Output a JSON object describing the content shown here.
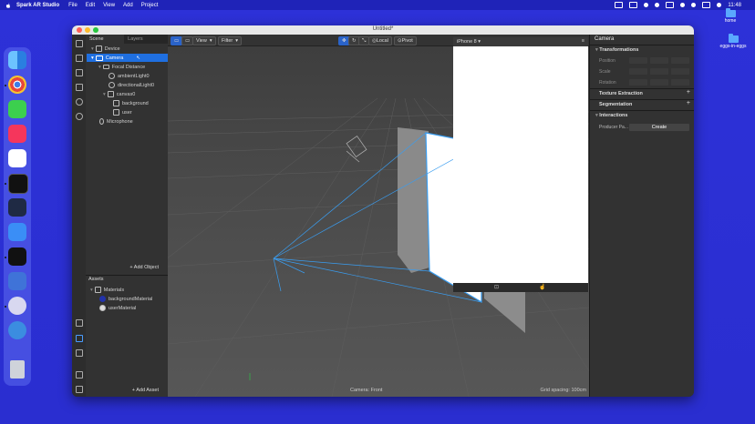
{
  "menubar": {
    "app_name": "Spark AR Studio",
    "items": [
      "File",
      "Edit",
      "View",
      "Add",
      "Project"
    ],
    "clock": "11:48"
  },
  "desktop": {
    "icons": [
      {
        "label": "home"
      },
      {
        "label": "eggs-in-eggs"
      }
    ]
  },
  "dock": {
    "apps": [
      {
        "name": "finder",
        "color": "#4ea3f5"
      },
      {
        "name": "chrome",
        "color": "#f2c94c"
      },
      {
        "name": "messages",
        "color": "#3ccf4e"
      },
      {
        "name": "music",
        "color": "#f5365c"
      },
      {
        "name": "slack",
        "color": "#ffffff"
      },
      {
        "name": "terminal",
        "color": "#111111"
      },
      {
        "name": "vscode",
        "color": "#2b8fe0"
      },
      {
        "name": "mail",
        "color": "#3a8ef6"
      },
      {
        "name": "figma",
        "color": "#111111"
      },
      {
        "name": "sourcetree",
        "color": "#3f73d8"
      },
      {
        "name": "spark-ar",
        "color": "#d8d8f0"
      },
      {
        "name": "tweetbot",
        "color": "#3b8de0"
      },
      {
        "name": "trash",
        "color": "#cfd3da"
      }
    ]
  },
  "window": {
    "title": "Untitled*",
    "traffic_lights": [
      "#ff5f57",
      "#febc2e",
      "#28c840"
    ]
  },
  "scene_panel": {
    "tabs": [
      {
        "label": "Scene"
      },
      {
        "label": "Layers"
      }
    ],
    "tree": [
      {
        "label": "Device",
        "icon": "device-icon",
        "indent": 0
      },
      {
        "label": "Camera",
        "icon": "camera-icon",
        "indent": 1,
        "selected": true
      },
      {
        "label": "Focal Distance",
        "icon": "focal-distance-icon",
        "indent": 2
      },
      {
        "label": "ambientLight0",
        "icon": "light-icon",
        "indent": 3
      },
      {
        "label": "directionalLight0",
        "icon": "light-icon",
        "indent": 3
      },
      {
        "label": "canvas0",
        "icon": "canvas-icon",
        "indent": 3
      },
      {
        "label": "background",
        "icon": "rectangle-icon",
        "indent": 4
      },
      {
        "label": "user",
        "icon": "rectangle-icon",
        "indent": 4
      },
      {
        "label": "Microphone",
        "icon": "microphone-icon",
        "indent": 1
      }
    ],
    "add_object_label": "Add Object"
  },
  "assets_panel": {
    "title": "Assets",
    "tree": [
      {
        "label": "Materials",
        "icon": "folder-icon",
        "indent": 0
      },
      {
        "label": "backgroundMaterial",
        "icon": "material-icon",
        "indent": 1
      },
      {
        "label": "userMaterial",
        "icon": "material-icon",
        "indent": 1
      }
    ],
    "add_asset_label": "Add Asset"
  },
  "viewport": {
    "view_label": "View",
    "filter_label": "Filter",
    "local_label": "Local",
    "pivot_label": "Pivot",
    "camera_label": "Camera: Front",
    "grid_spacing": "Grid spacing: 100cm"
  },
  "simulator": {
    "device": "iPhone 8"
  },
  "inspector": {
    "title": "Camera",
    "transformations_label": "Transformations",
    "position_label": "Position",
    "scale_label": "Scale",
    "rotation_label": "Rotation",
    "texture_extraction_label": "Texture Extraction",
    "segmentation_label": "Segmentation",
    "interactions_label": "Interactions",
    "producer_label": "Producer Pa...",
    "create_label": "Create"
  }
}
